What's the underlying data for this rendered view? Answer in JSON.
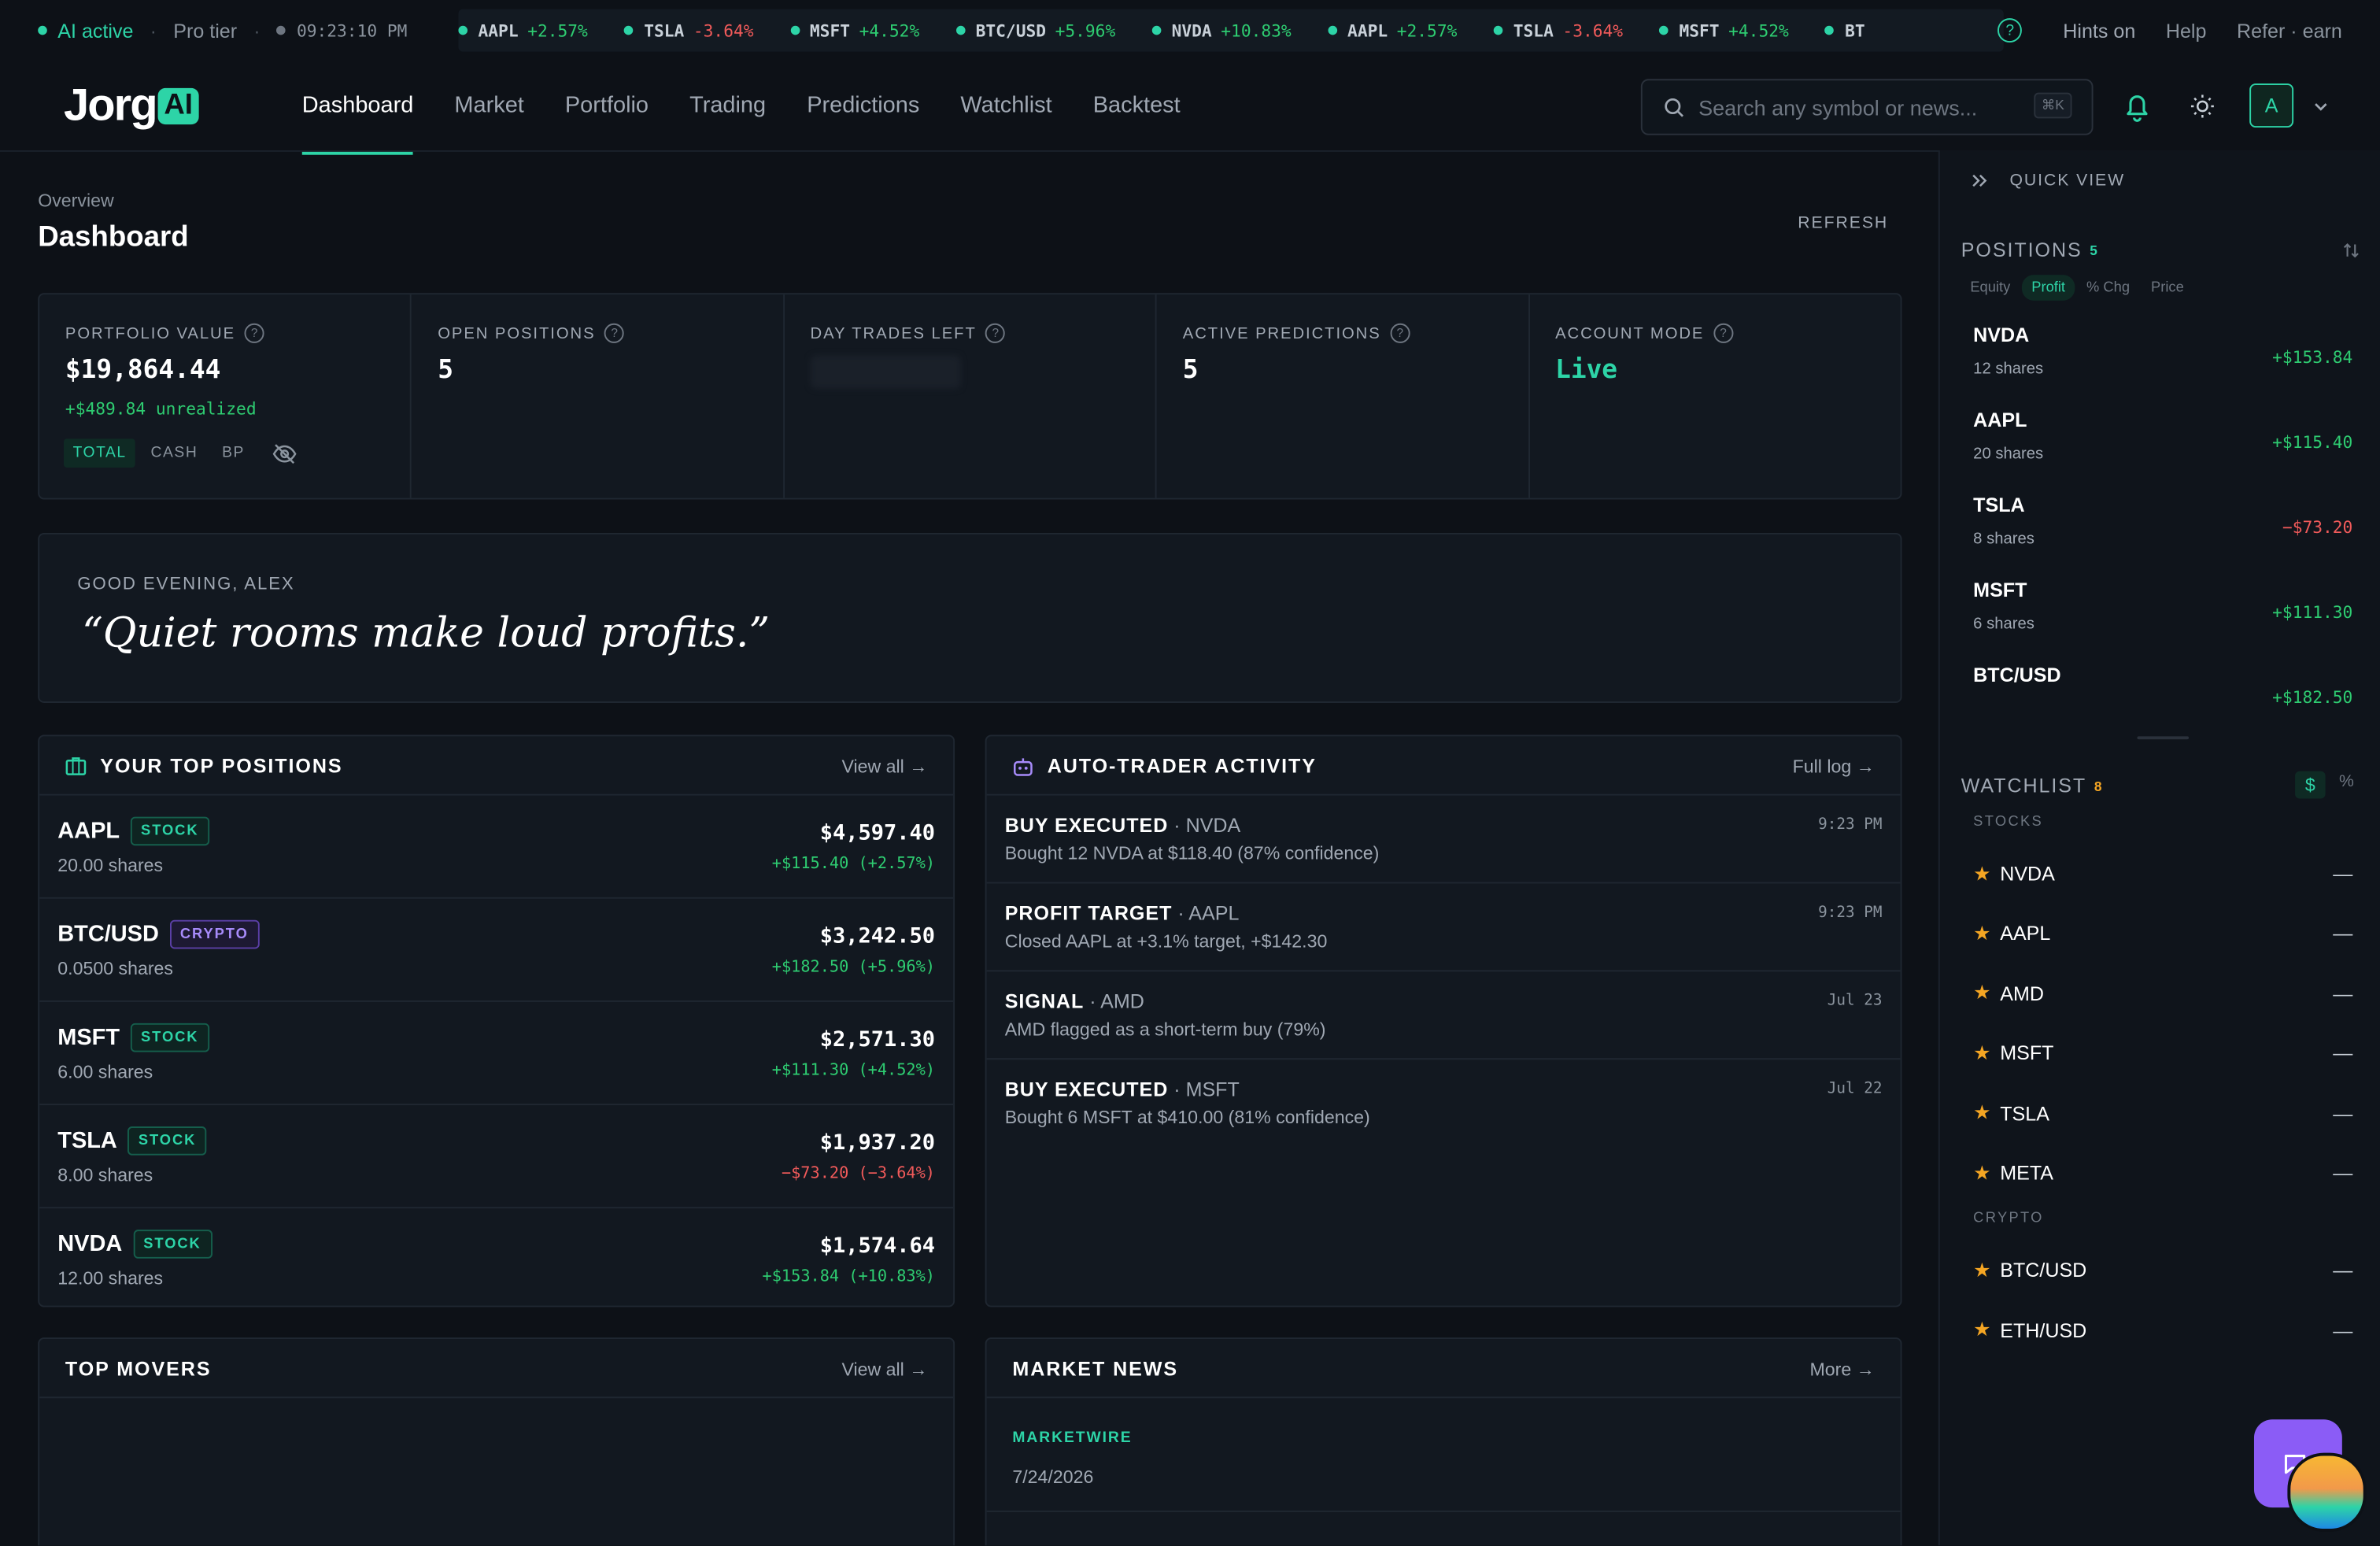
{
  "topbar": {
    "ai_status": "AI active",
    "tier": "Pro tier",
    "clock": "09:23:10 PM",
    "ticker": [
      {
        "sym": "AAPL",
        "chg": "+2.57%",
        "dir": "up"
      },
      {
        "sym": "TSLA",
        "chg": "-3.64%",
        "dir": "dn"
      },
      {
        "sym": "MSFT",
        "chg": "+4.52%",
        "dir": "up"
      },
      {
        "sym": "BTC/USD",
        "chg": "+5.96%",
        "dir": "up"
      },
      {
        "sym": "NVDA",
        "chg": "+10.83%",
        "dir": "up"
      },
      {
        "sym": "AAPL",
        "chg": "+2.57%",
        "dir": "up"
      },
      {
        "sym": "TSLA",
        "chg": "-3.64%",
        "dir": "dn"
      },
      {
        "sym": "MSFT",
        "chg": "+4.52%",
        "dir": "up"
      },
      {
        "sym": "BT",
        "chg": "",
        "dir": "up"
      }
    ],
    "hints": "Hints on",
    "help": "Help",
    "refer": "Refer · earn"
  },
  "nav": {
    "logo_text": "Jorg",
    "logo_badge": "AI",
    "tabs": [
      "Dashboard",
      "Market",
      "Portfolio",
      "Trading",
      "Predictions",
      "Watchlist",
      "Backtest"
    ],
    "active_tab": "Dashboard",
    "search_placeholder": "Search any symbol or news...",
    "search_shortcut": "⌘K",
    "avatar_initial": "A"
  },
  "header": {
    "breadcrumb": "Overview",
    "title": "Dashboard",
    "refresh": "REFRESH"
  },
  "kpis": [
    {
      "label": "PORTFOLIO VALUE",
      "value": "$19,864.44",
      "sub": "+$489.84 unrealized",
      "pills": [
        "TOTAL",
        "CASH",
        "BP"
      ]
    },
    {
      "label": "OPEN POSITIONS",
      "value": "5"
    },
    {
      "label": "DAY TRADES LEFT",
      "value": ""
    },
    {
      "label": "ACTIVE PREDICTIONS",
      "value": "5"
    },
    {
      "label": "ACCOUNT MODE",
      "value": "Live"
    }
  ],
  "greeting": {
    "label": "GOOD EVENING, ALEX",
    "quote": "“Quiet rooms make loud profits.”"
  },
  "top_positions": {
    "title": "YOUR TOP POSITIONS",
    "link": "View all →",
    "rows": [
      {
        "sym": "AAPL",
        "type": "STOCK",
        "shares": "20.00 shares",
        "value": "$4,597.40",
        "chg": "+$115.40 (+2.57%)",
        "dir": "up"
      },
      {
        "sym": "BTC/USD",
        "type": "CRYPTO",
        "shares": "0.0500 shares",
        "value": "$3,242.50",
        "chg": "+$182.50 (+5.96%)",
        "dir": "up"
      },
      {
        "sym": "MSFT",
        "type": "STOCK",
        "shares": "6.00 shares",
        "value": "$2,571.30",
        "chg": "+$111.30 (+4.52%)",
        "dir": "up"
      },
      {
        "sym": "TSLA",
        "type": "STOCK",
        "shares": "8.00 shares",
        "value": "$1,937.20",
        "chg": "−$73.20 (−3.64%)",
        "dir": "dn"
      },
      {
        "sym": "NVDA",
        "type": "STOCK",
        "shares": "12.00 shares",
        "value": "$1,574.64",
        "chg": "+$153.84 (+10.83%)",
        "dir": "up"
      }
    ]
  },
  "activity": {
    "title": "AUTO-TRADER ACTIVITY",
    "link": "Full log →",
    "rows": [
      {
        "kind": "BUY EXECUTED",
        "sym": "NVDA",
        "desc": "Bought 12 NVDA at $118.40 (87% confidence)",
        "time": "9:23 PM"
      },
      {
        "kind": "PROFIT TARGET",
        "sym": "AAPL",
        "desc": "Closed AAPL at +3.1% target, +$142.30",
        "time": "9:23 PM"
      },
      {
        "kind": "SIGNAL",
        "sym": "AMD",
        "desc": "AMD flagged as a short-term buy (79%)",
        "time": "Jul 23"
      },
      {
        "kind": "BUY EXECUTED",
        "sym": "MSFT",
        "desc": "Bought 6 MSFT at $410.00 (81% confidence)",
        "time": "Jul 22"
      }
    ]
  },
  "movers": {
    "title": "TOP MOVERS",
    "link": "View all →"
  },
  "news": {
    "title": "MARKET NEWS",
    "link": "More →",
    "source": "MARKETWIRE",
    "date": "7/24/2026"
  },
  "quickview": {
    "title": "QUICK VIEW",
    "positions_label": "POSITIONS",
    "positions_count": "5",
    "seg": [
      "Equity",
      "Profit",
      "% Chg",
      "Price"
    ],
    "seg_active": "Profit",
    "rows": [
      {
        "sym": "NVDA",
        "shares": "12 shares",
        "pl": "+$153.84",
        "dir": "up"
      },
      {
        "sym": "AAPL",
        "shares": "20 shares",
        "pl": "+$115.40",
        "dir": "up"
      },
      {
        "sym": "TSLA",
        "shares": "8 shares",
        "pl": "−$73.20",
        "dir": "dn"
      },
      {
        "sym": "MSFT",
        "shares": "6 shares",
        "pl": "+$111.30",
        "dir": "up"
      },
      {
        "sym": "BTC/USD",
        "shares": "",
        "pl": "+$182.50",
        "dir": "up"
      }
    ],
    "watchlist_label": "WATCHLIST",
    "watchlist_count": "8",
    "wl_toggle": [
      "$",
      "%"
    ],
    "stocks_label": "STOCKS",
    "stocks": [
      "NVDA",
      "AAPL",
      "AMD",
      "MSFT",
      "TSLA",
      "META"
    ],
    "crypto_label": "CRYPTO",
    "crypto": [
      "BTC/USD",
      "ETH/USD"
    ],
    "empty_value": "—"
  },
  "colors": {
    "accent": "#2dd4a7",
    "up": "#2ecc71",
    "down": "#f05a5a",
    "purple": "#8b5cf6"
  }
}
